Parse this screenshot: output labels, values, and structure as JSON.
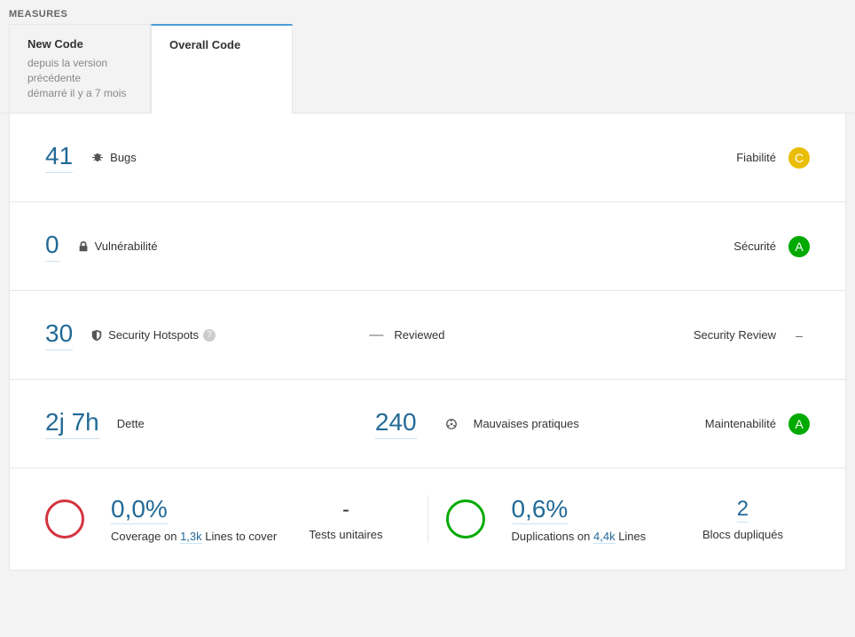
{
  "header": "MEASURES",
  "tabs": {
    "new_code": {
      "title": "New Code",
      "sub1": "depuis la version précédente",
      "sub2": "démarré il y a 7 mois"
    },
    "overall": {
      "title": "Overall Code"
    }
  },
  "bugs": {
    "value": "41",
    "label": "Bugs",
    "right_label": "Fiabilité",
    "rating": "C"
  },
  "vuln": {
    "value": "0",
    "label": "Vulnérabilité",
    "right_label": "Sécurité",
    "rating": "A"
  },
  "hotspots": {
    "value": "30",
    "label": "Security Hotspots",
    "reviewed_dash": "—",
    "reviewed_label": "Reviewed",
    "right_label": "Security Review",
    "rating": "–"
  },
  "maint": {
    "debt_value": "2j 7h",
    "debt_label": "Dette",
    "smells_value": "240",
    "smells_label": "Mauvaises pratiques",
    "right_label": "Maintenabilité",
    "rating": "A"
  },
  "coverage": {
    "pct": "0,0%",
    "sub_prefix": "Coverage on ",
    "lines": "1,3k",
    "sub_suffix": " Lines to cover",
    "tests_val": "-",
    "tests_label": "Tests unitaires"
  },
  "dup": {
    "pct": "0,6%",
    "sub_prefix": "Duplications on ",
    "lines": "4,4k",
    "sub_suffix": " Lines",
    "blocks_val": "2",
    "blocks_label": "Blocs dupliqués"
  }
}
